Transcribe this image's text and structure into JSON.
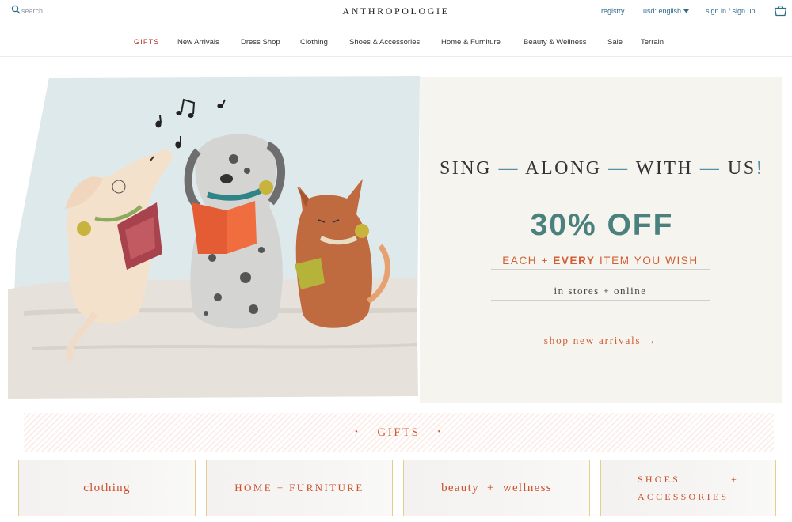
{
  "header": {
    "search_placeholder": "search",
    "logo": "ANTHROPOLOGIE",
    "registry": "registry",
    "currency": "usd: english",
    "signin": "sign in / sign up"
  },
  "nav": {
    "items": [
      "GIFTS",
      "New Arrivals",
      "Dress Shop",
      "Clothing",
      "Shoes & Accessories",
      "Home & Furniture",
      "Beauty & Wellness",
      "Sale",
      "Terrain"
    ]
  },
  "hero": {
    "title_words": [
      "SING",
      "ALONG",
      "WITH",
      "US"
    ],
    "title_separator": "—",
    "title_end": "!",
    "offer": "30% OFF",
    "sub_pre": "EACH + ",
    "sub_bold": "EVERY",
    "sub_post": " ITEM YOU WISH",
    "note": "in stores + online",
    "cta": "shop new arrivals →"
  },
  "gifts_banner": {
    "dot": "•",
    "label": "GIFTS"
  },
  "categories": [
    {
      "label": "clothing"
    },
    {
      "label": "HOME + FURNITURE"
    },
    {
      "label": "beauty  +  wellness"
    },
    {
      "line1": "SHOES",
      "plus": "+",
      "line2": "ACCESSORIES"
    }
  ],
  "colors": {
    "accent_red": "#d15e34",
    "teal": "#4a807d",
    "link_blue": "#2e6c8a",
    "gifts_red": "#b3312b"
  },
  "icons": [
    "search-icon",
    "chevron-down-icon",
    "shopping-bag-icon"
  ]
}
